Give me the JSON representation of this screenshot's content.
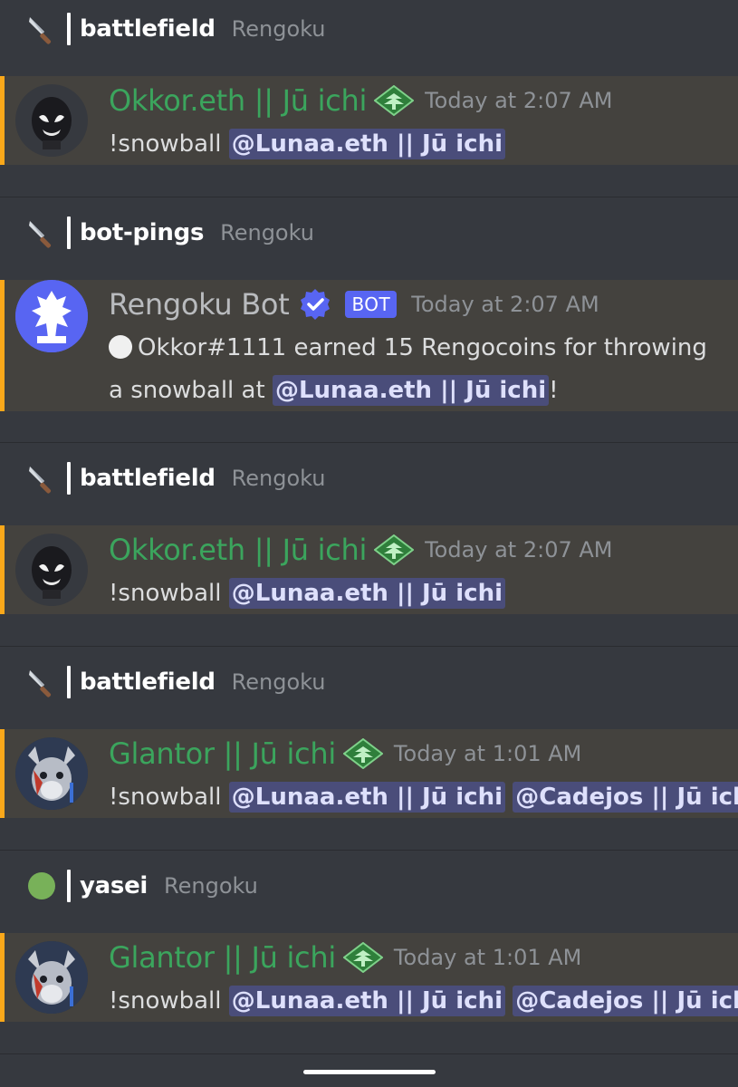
{
  "colors": {
    "background": "#36393f",
    "message_highlight": "#44423e",
    "mention_bar": "#faa81a",
    "username_green": "#3ba55d",
    "mention_bg": "#4a4d7a",
    "bot_blurple": "#5865f2"
  },
  "entries": [
    {
      "channel_icon": "knife-icon",
      "channel": "battlefield",
      "server": "Rengoku",
      "author": "Okkor.eth || Jū ichi",
      "avatar": "venom-avatar",
      "role_icon": "bonsai-icon",
      "time": "Today at 2:07 AM",
      "text": "!snowball ",
      "mentions": [
        "@Lunaa.eth || Jū ichi"
      ]
    },
    {
      "channel_icon": "knife-icon",
      "channel": "bot-pings",
      "server": "Rengoku",
      "author": "Rengoku Bot",
      "avatar": "rengoku-bot-avatar",
      "verified_icon": "verified-badge-icon",
      "bot_tag": "BOT",
      "time": "Today at 2:07 AM",
      "line1": "Okkor#1111 earned 15 Rengocoins for throwing",
      "line2_prefix": "a snowball at ",
      "mention": "@Lunaa.eth || Jū ichi",
      "line2_suffix": "!"
    },
    {
      "channel_icon": "knife-icon",
      "channel": "battlefield",
      "server": "Rengoku",
      "author": "Okkor.eth || Jū ichi",
      "avatar": "venom-avatar",
      "role_icon": "bonsai-icon",
      "time": "Today at 2:07 AM",
      "text": "!snowball ",
      "mentions": [
        "@Lunaa.eth || Jū ichi"
      ]
    },
    {
      "channel_icon": "knife-icon",
      "channel": "battlefield",
      "server": "Rengoku",
      "author": "Glantor || Jū ichi",
      "avatar": "wolf-avatar",
      "role_icon": "bonsai-icon",
      "time": "Today at 1:01 AM",
      "text": "!snowball ",
      "mentions": [
        "@Lunaa.eth || Jū ichi",
        "@Cadejos || Jū ichi"
      ]
    },
    {
      "channel_icon": "green-circle-icon",
      "channel": "yasei",
      "server": "Rengoku",
      "author": "Glantor || Jū ichi",
      "avatar": "wolf-avatar",
      "role_icon": "bonsai-icon",
      "time": "Today at 1:01 AM",
      "text": "!snowball ",
      "mentions": [
        "@Lunaa.eth || Jū ichi",
        "@Cadejos || Jū ichi"
      ]
    }
  ]
}
